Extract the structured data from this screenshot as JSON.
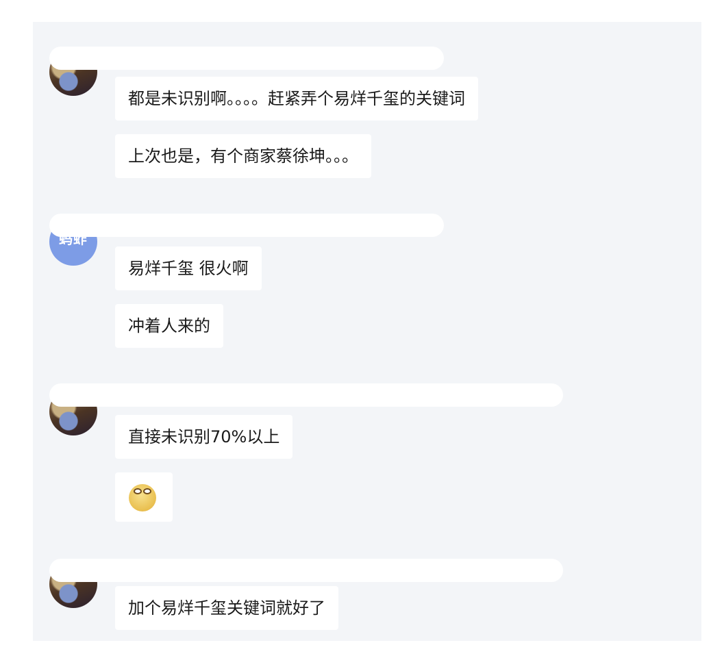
{
  "conversation": [
    {
      "avatar": {
        "style": "photo",
        "text": ""
      },
      "messages": [
        {
          "type": "text",
          "text": "都是未识别啊。。。。赶紧弄个易烊千玺的关键词"
        },
        {
          "type": "text",
          "text": "上次也是，有个商家蔡徐坤。。。"
        }
      ]
    },
    {
      "avatar": {
        "style": "text",
        "text": "蚂蚱"
      },
      "messages": [
        {
          "type": "text",
          "text": "易烊千玺  很火啊"
        },
        {
          "type": "text",
          "text": "冲着人来的"
        }
      ]
    },
    {
      "avatar": {
        "style": "photo",
        "text": ""
      },
      "messages": [
        {
          "type": "text",
          "text": "直接未识别70%以上"
        },
        {
          "type": "emoji",
          "icon": "awkward-face-emoji-icon"
        }
      ]
    },
    {
      "avatar": {
        "style": "photo",
        "text": ""
      },
      "messages": [
        {
          "type": "text",
          "text": "加个易烊千玺关键词就好了"
        }
      ]
    }
  ],
  "colors": {
    "panel_background": "#f3f5f8",
    "bubble_background": "#ffffff",
    "text": "#1a1a1a",
    "avatar_blue": "#7d9ce6"
  }
}
